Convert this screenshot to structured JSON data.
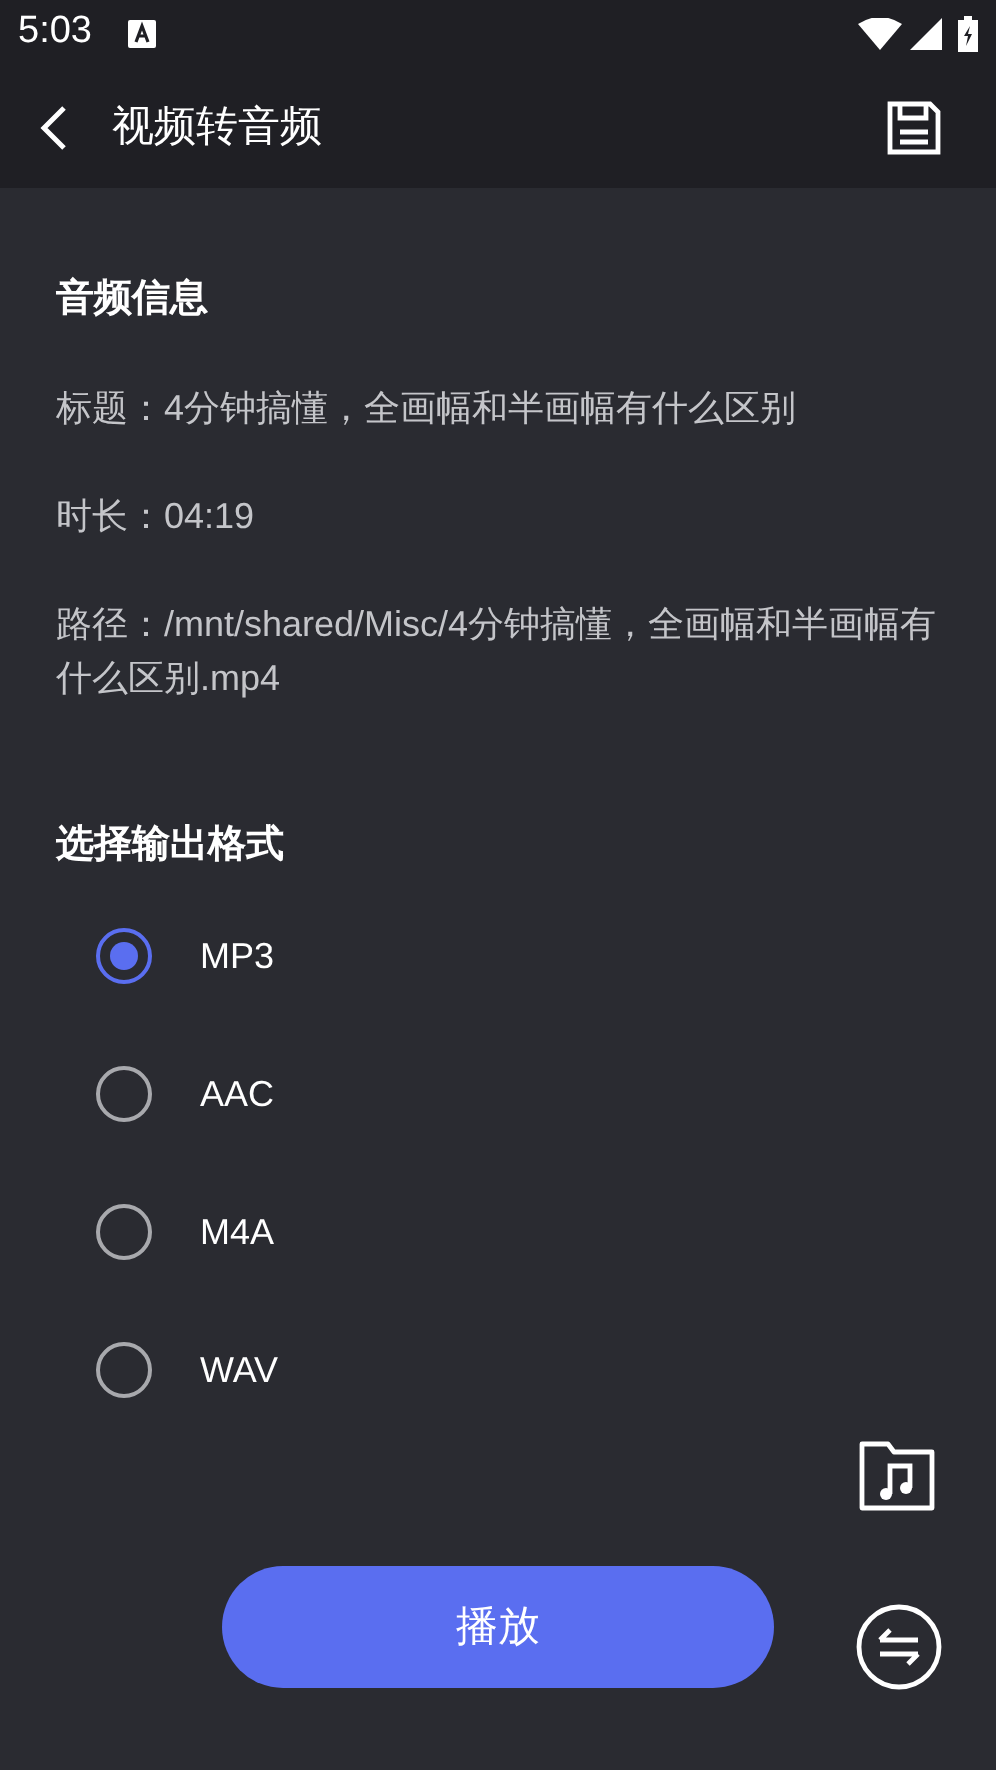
{
  "status_bar": {
    "time": "5:03"
  },
  "header": {
    "title": "视频转音频"
  },
  "audio_info": {
    "heading": "音频信息",
    "lines": [
      "标题：4分钟搞懂，全画幅和半画幅有什么区别",
      "时长：04:19",
      "路径：/mnt/shared/Misc/4分钟搞懂，全画幅和半画幅有什么区别.mp4"
    ]
  },
  "output_format": {
    "heading": "选择输出格式",
    "options": [
      {
        "label": "MP3",
        "selected": true
      },
      {
        "label": "AAC",
        "selected": false
      },
      {
        "label": "M4A",
        "selected": false
      },
      {
        "label": "WAV",
        "selected": false
      }
    ]
  },
  "play_button": {
    "label": "播放"
  }
}
